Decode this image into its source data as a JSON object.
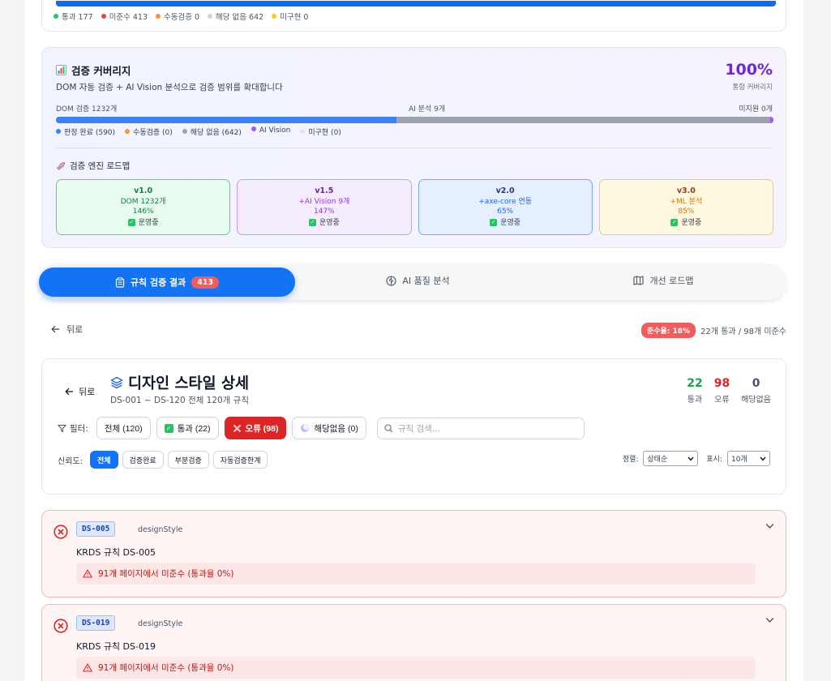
{
  "summary": {
    "legend": [
      {
        "label": "통과 177",
        "color": "#22c55e"
      },
      {
        "label": "미준수 413",
        "color": "#ef4444"
      },
      {
        "label": "수동검증 0",
        "color": "#fb923c"
      },
      {
        "label": "해당 없음 642",
        "color": "#d1d5db"
      },
      {
        "label": "미구현 0",
        "color": "#facc15"
      }
    ]
  },
  "coverage": {
    "icon": "bar-chart-icon",
    "title": "검증 커버리지",
    "subtitle": "DOM 자동 검증 + AI Vision 분석으로 검증 범위를 확대합니다",
    "percent": "100%",
    "percent_label": "통합 커버리지",
    "dom_label": "DOM 검증 1232개",
    "ai_label": "AI 분석 9개",
    "missing_label": "미지원 0개",
    "bar": {
      "dom_fraction": 0.475,
      "ai_fraction": 0.52,
      "missing_fraction": 0.005
    },
    "legend": [
      {
        "label": "판정 완료 (590)",
        "color": "#3b82f6"
      },
      {
        "label": "수동검증 (0)",
        "color": "#fb923c"
      },
      {
        "label": "해당 없음 (642)",
        "color": "#9ca3af"
      },
      {
        "label": "AI Vision",
        "color": "#a855f7"
      },
      {
        "label": "미구현 (0)",
        "color": "#e5e7eb"
      }
    ],
    "roadmap_title": "검증 엔진 로드맵",
    "roadmap": [
      {
        "version": "v1.0",
        "desc": "DOM 1232개",
        "pct": "146%",
        "status": "운영중"
      },
      {
        "version": "v1.5",
        "desc": "+AI Vision 9개",
        "pct": "147%",
        "status": "운영중"
      },
      {
        "version": "v2.0",
        "desc": "+axe-core 연동",
        "pct": "65%",
        "status": "운영중"
      },
      {
        "version": "v3.0",
        "desc": "+ML 분석",
        "pct": "85%",
        "status": "운영중"
      }
    ]
  },
  "tabs": [
    {
      "label": "규칙 검증 결과",
      "badge": "413",
      "icon": "clipboard-icon"
    },
    {
      "label": "AI 품질 분석",
      "icon": "brain-icon"
    },
    {
      "label": "개선 로드맵",
      "icon": "map-icon"
    }
  ],
  "back": {
    "label": "뒤로"
  },
  "compliance": {
    "badge": "준수율: 18%",
    "text": "22개 통과 / 98개 미준수"
  },
  "detail": {
    "back_label": "뒤로",
    "title": "디자인 스타일 상세",
    "subtitle": "DS-001 ~ DS-120 전체 120개 규칙",
    "stats": [
      {
        "value": "22",
        "label": "통과",
        "color": "#16a34a"
      },
      {
        "value": "98",
        "label": "오류",
        "color": "#dc2626"
      },
      {
        "value": "0",
        "label": "해당없음",
        "color": "#4b5563"
      }
    ],
    "filter_label": "필터:",
    "filters": [
      {
        "label": "전체 (120)",
        "active": false
      },
      {
        "label": "통과 (22)",
        "active": false
      },
      {
        "label": "오류 (98)",
        "active": true
      },
      {
        "label": "해당없음 (0)",
        "active": false
      }
    ],
    "search_placeholder": "규칙 검색...",
    "trust_label": "신뢰도:",
    "trust": [
      {
        "label": "전체",
        "active": true
      },
      {
        "label": "검증완료",
        "active": false
      },
      {
        "label": "부분검증",
        "active": false
      },
      {
        "label": "자동검증한계",
        "active": false
      }
    ],
    "sort_label": "정렬:",
    "sort_value": "상태순",
    "show_label": "표시:",
    "show_value": "10개"
  },
  "rules": [
    {
      "code": "DS-005",
      "category": "designStyle",
      "name": "KRDS 규칙 DS-005",
      "warning": "91개 페이지에서 미준수 (통과율 0%)"
    },
    {
      "code": "DS-019",
      "category": "designStyle",
      "name": "KRDS 규칙 DS-019",
      "warning": "91개 페이지에서 미준수 (통과율 0%)"
    }
  ]
}
